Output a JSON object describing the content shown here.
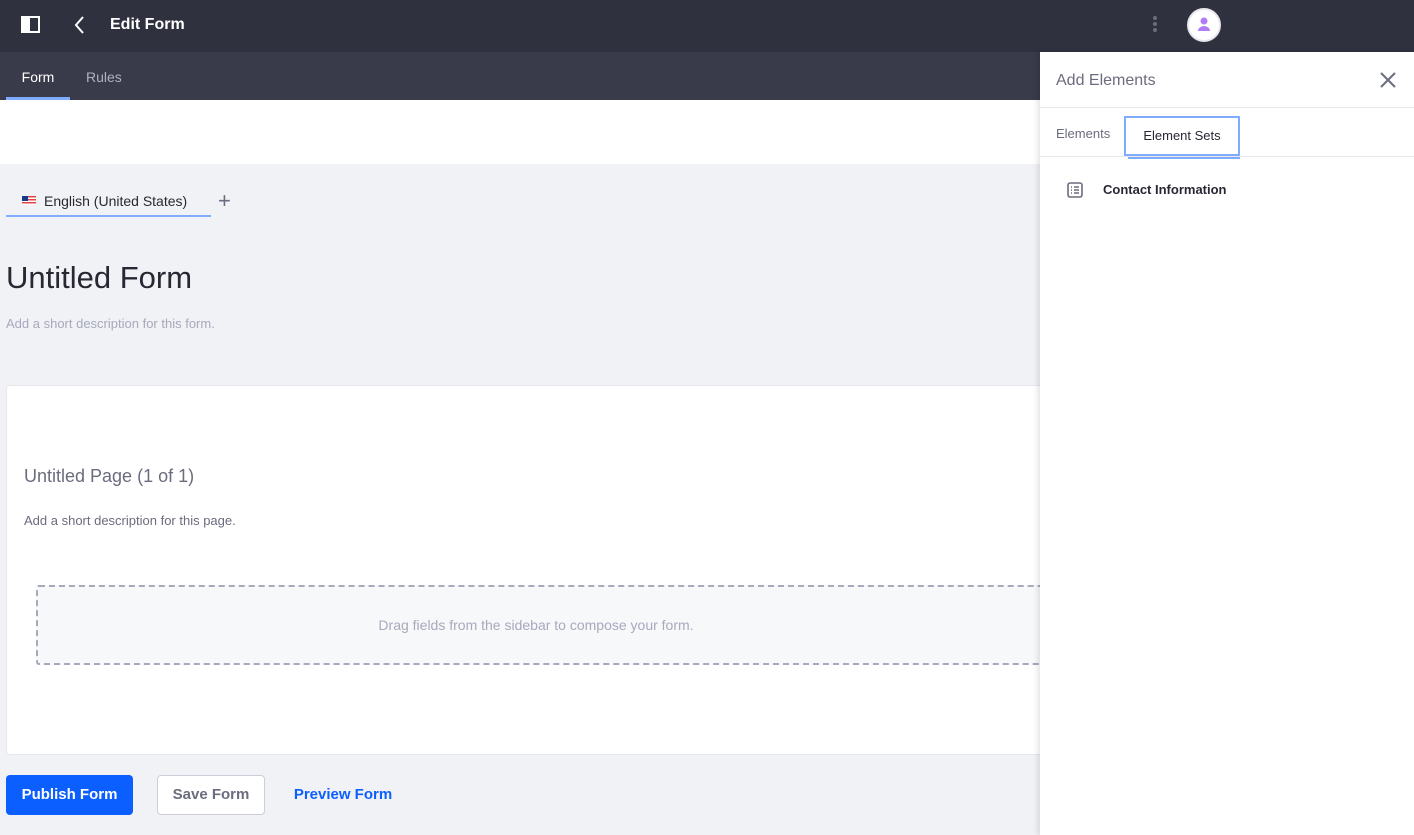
{
  "header": {
    "title": "Edit Form",
    "icons": [
      "sidebar-toggle-icon",
      "back-chevron-icon",
      "kebab-menu-icon",
      "user-avatar-icon"
    ]
  },
  "tabs": [
    {
      "label": "Form",
      "active": true
    },
    {
      "label": "Rules",
      "active": false
    }
  ],
  "language": {
    "label": "English (United States)",
    "icon": "us-flag-icon"
  },
  "form": {
    "title": "Untitled Form",
    "description_placeholder": "Add a short description for this form.",
    "page": {
      "title": "Untitled Page (1 of 1)",
      "description_placeholder": "Add a short description for this page.",
      "drop_hint": "Drag fields from the sidebar to compose your form."
    }
  },
  "actions": {
    "publish": "Publish Form",
    "save": "Save Form",
    "preview": "Preview Form"
  },
  "sidebar": {
    "title": "Add Elements",
    "tabs": [
      {
        "label": "Elements",
        "active": false
      },
      {
        "label": "Element Sets",
        "active": true
      }
    ],
    "items": [
      {
        "label": "Contact Information",
        "icon": "list-icon"
      }
    ]
  },
  "colors": {
    "primary": "#0b5fff",
    "topbar": "#30313f",
    "tabbar": "#393a4a",
    "accent": "#80acff",
    "avatar": "#b07cf5"
  }
}
